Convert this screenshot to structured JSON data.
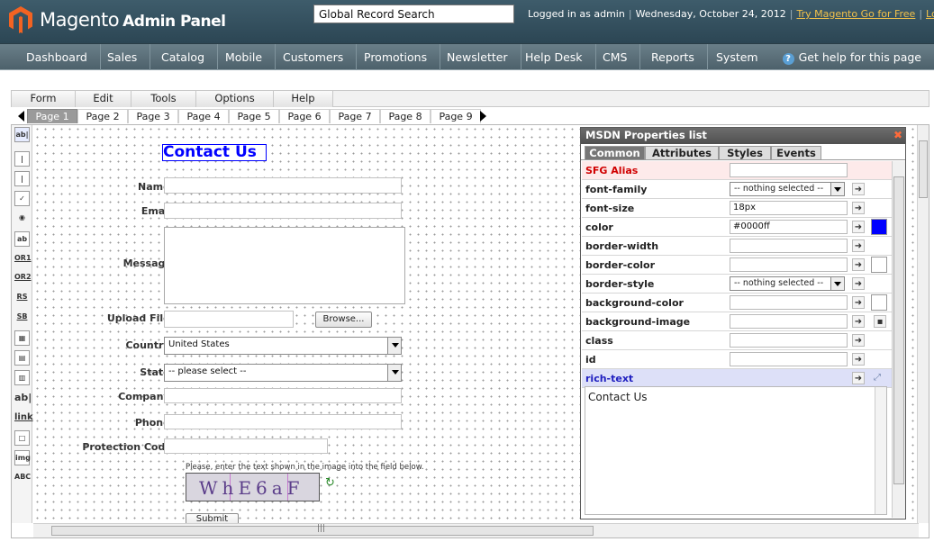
{
  "header": {
    "logo_text": "Magento",
    "logo_sub": "Admin Panel",
    "search_value": "Global Record Search",
    "logged_in": "Logged in as admin",
    "date": "Wednesday, October 24, 2012",
    "try_link": "Try Magento Go for Free",
    "logout_link": "Log Out"
  },
  "nav": {
    "items": [
      "Dashboard",
      "Sales",
      "Catalog",
      "Mobile",
      "Customers",
      "Promotions",
      "Newsletter",
      "Help Desk",
      "CMS",
      "Reports",
      "System"
    ],
    "help": "Get help for this page"
  },
  "menubar": [
    "Form",
    "Edit",
    "Tools",
    "Options",
    "Help"
  ],
  "pages": [
    "Page 1",
    "Page 2",
    "Page 3",
    "Page 4",
    "Page 5",
    "Page 6",
    "Page 7",
    "Page 8",
    "Page 9"
  ],
  "toolbox": [
    "ab|",
    "|",
    "✓",
    "◉",
    "ab",
    "OR1",
    "OR2",
    "RS",
    "SB",
    "▦",
    "▤",
    "▥",
    "ab|",
    "link",
    "□",
    "img",
    "ABC"
  ],
  "form": {
    "title": "Contact Us",
    "name_label": "Name:",
    "email_label": "Email:",
    "message_label": "Message:",
    "upload_label": "Upload File:",
    "browse_label": "Browse...",
    "country_label": "Country:",
    "country_value": "United States",
    "state_label": "State:",
    "state_value": "-- please select --",
    "company_label": "Company:",
    "phone_label": "Phone:",
    "protection_label": "Protection Code:",
    "captcha_hint": "Please, enter the text shown in the image into the field below.",
    "captcha_text": "WhE6aF",
    "submit_label": "Submit"
  },
  "props": {
    "title": "MSDN Properties list",
    "tabs": [
      "Common",
      "Attributes",
      "Styles",
      "Events"
    ],
    "rows": [
      {
        "label": "SFG Alias",
        "value": ""
      },
      {
        "label": "font-family",
        "value": "-- nothing selected --"
      },
      {
        "label": "font-size",
        "value": "18px"
      },
      {
        "label": "color",
        "value": "#0000ff"
      },
      {
        "label": "border-width",
        "value": ""
      },
      {
        "label": "border-color",
        "value": ""
      },
      {
        "label": "border-style",
        "value": "-- nothing selected --"
      },
      {
        "label": "background-color",
        "value": ""
      },
      {
        "label": "background-image",
        "value": ""
      },
      {
        "label": "class",
        "value": ""
      },
      {
        "label": "id",
        "value": ""
      },
      {
        "label": "rich-text",
        "value": ""
      }
    ],
    "rich_text": "Contact Us",
    "colors": {
      "swatch_blue": "#0000ff",
      "alias_red": "#d00000",
      "rich_blue": "#2020c0"
    }
  }
}
